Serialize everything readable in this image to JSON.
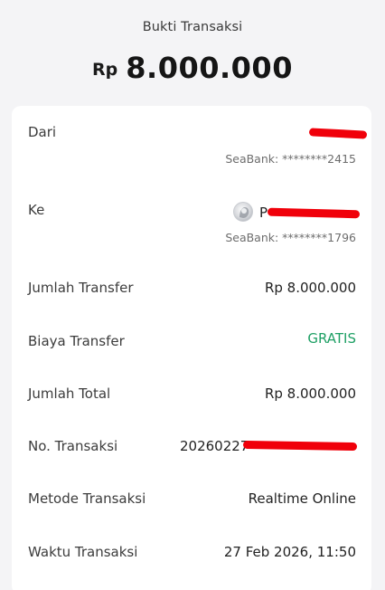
{
  "header": {
    "title": "Bukti Transaksi",
    "currency": "Rp",
    "amount": "8.000.000"
  },
  "from": {
    "label": "Dari",
    "account": "SeaBank: ********2415"
  },
  "to": {
    "label": "Ke",
    "name_visible": "P",
    "account": "SeaBank: ********1796"
  },
  "rows": [
    {
      "label": "Jumlah Transfer",
      "value": "Rp 8.000.000"
    },
    {
      "label": "Biaya Transfer",
      "value": "GRATIS"
    },
    {
      "label": "Jumlah Total",
      "value": "Rp 8.000.000"
    },
    {
      "label": "No. Transaksi",
      "value": "20260227"
    },
    {
      "label": "Metode Transaksi",
      "value": "Realtime Online"
    },
    {
      "label": "Waktu Transaksi",
      "value": "27 Feb 2026, 11:50"
    }
  ],
  "colors": {
    "accent_green": "#1fa065",
    "redaction": "#f0000a",
    "background": "#f4f4f6"
  }
}
